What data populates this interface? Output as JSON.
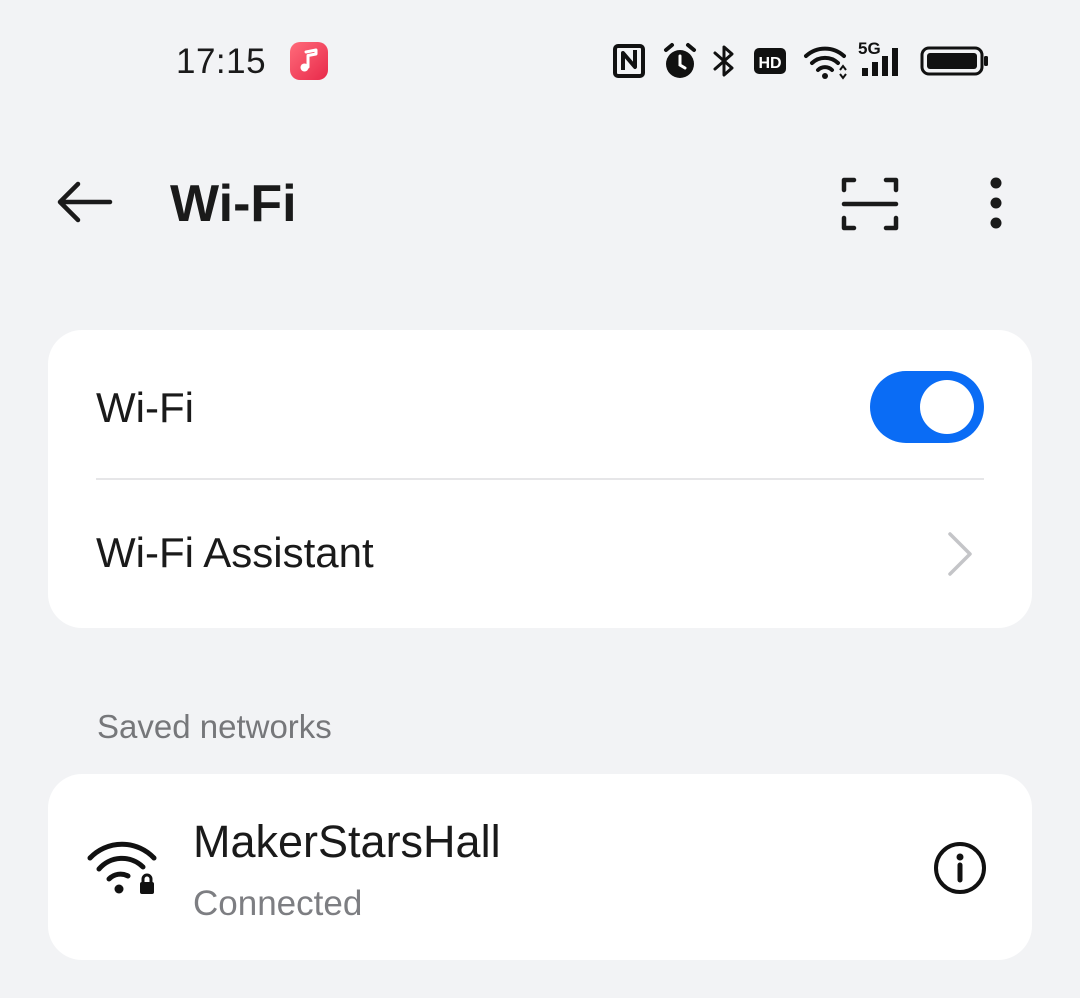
{
  "status_bar": {
    "time": "17:15",
    "app_icon": "music-note-icon",
    "icons": [
      "nfc-icon",
      "alarm-icon",
      "bluetooth-icon",
      "hd-icon",
      "wifi-icon",
      "5g-signal-icon",
      "battery-icon"
    ],
    "network_label": "5G"
  },
  "app_bar": {
    "title": "Wi-Fi",
    "back_icon": "back-arrow-icon",
    "scan_icon": "scan-icon",
    "more_icon": "more-vertical-icon"
  },
  "settings": {
    "wifi_label": "Wi-Fi",
    "wifi_enabled": true,
    "assistant_label": "Wi-Fi Assistant"
  },
  "saved_networks": {
    "header": "Saved networks",
    "items": [
      {
        "name": "MakerStarsHall",
        "status": "Connected",
        "secured": true
      }
    ]
  },
  "colors": {
    "background": "#f2f3f5",
    "card": "#ffffff",
    "accent": "#0a6cf5",
    "secondary_text": "#7d7e82"
  }
}
